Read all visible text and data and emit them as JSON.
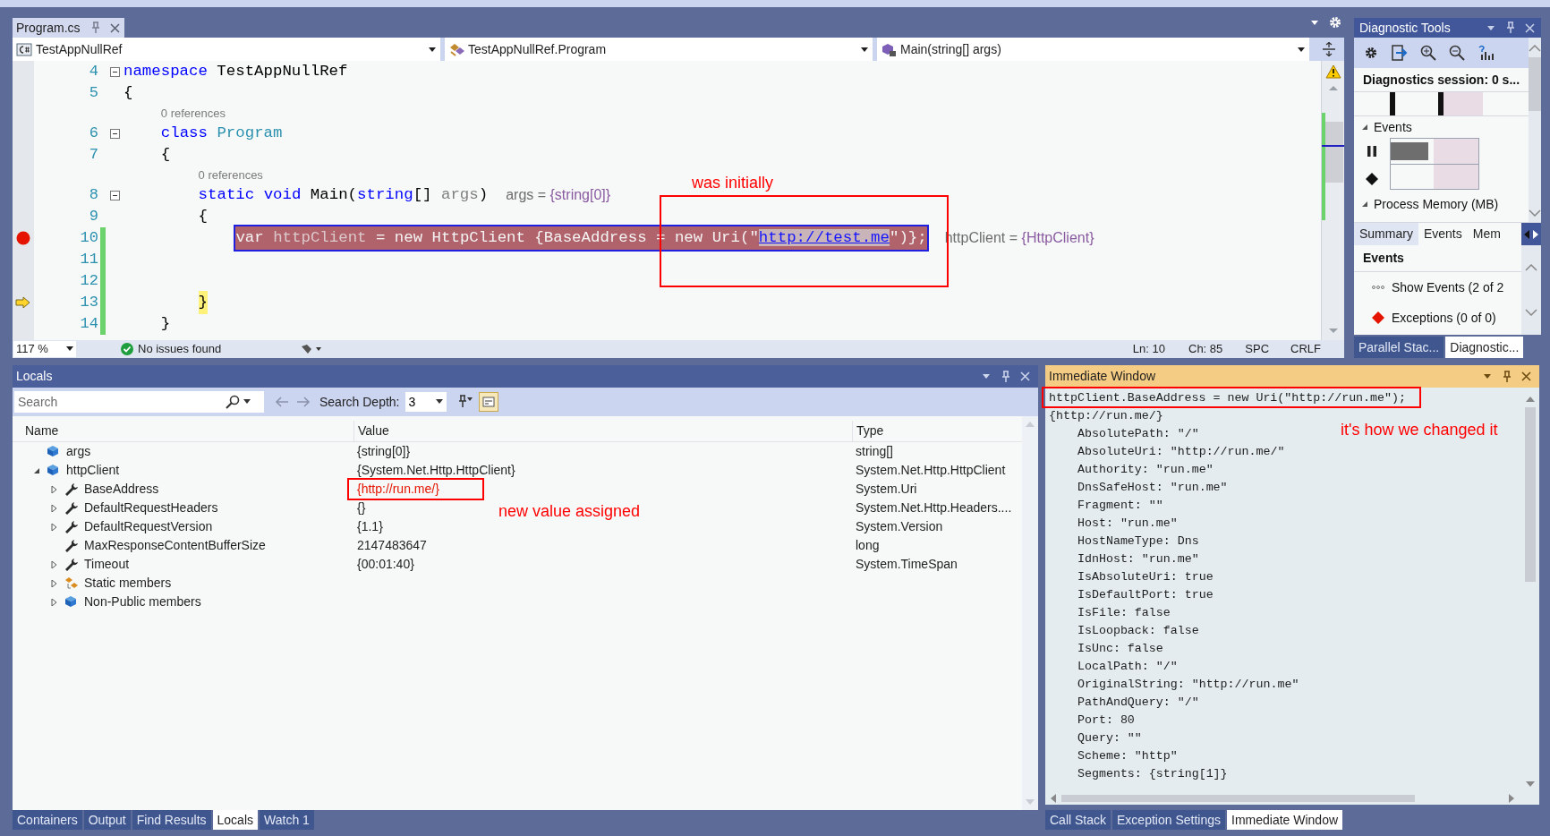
{
  "editor": {
    "tab": "Program.cs",
    "nav": [
      {
        "kind": "project",
        "label": "TestAppNullRef"
      },
      {
        "kind": "class",
        "label": "TestAppNullRef.Program"
      },
      {
        "kind": "method",
        "label": "Main(string[] args)"
      }
    ],
    "lines": [
      {
        "kind": "code",
        "number": "4",
        "foldable": true,
        "breakpoint": false,
        "current": false,
        "changed": false,
        "highlighted": false,
        "tokens": [
          {
            "kind": "keyword",
            "text": "namespace"
          },
          {
            "kind": "plain",
            "text": " TestAppNullRef"
          }
        ]
      },
      {
        "kind": "code",
        "number": "5",
        "foldable": false,
        "breakpoint": false,
        "current": false,
        "changed": false,
        "highlighted": false,
        "tokens": [
          {
            "kind": "plain",
            "text": "{"
          }
        ],
        "children": [
          {
            "kind": "lens",
            "foldable": false,
            "breakpoint": false,
            "current": false,
            "changed": false,
            "highlighted": false,
            "tokens": [
              {
                "kind": "lens",
                "text": "0 references"
              }
            ]
          },
          {
            "kind": "code",
            "number": "6",
            "foldable": true,
            "breakpoint": false,
            "current": false,
            "changed": false,
            "highlighted": false,
            "tokens": [
              {
                "kind": "keyword",
                "text": "class"
              },
              {
                "kind": "type",
                "text": " Program"
              }
            ]
          },
          {
            "kind": "code",
            "number": "7",
            "foldable": false,
            "breakpoint": false,
            "current": false,
            "changed": false,
            "highlighted": false,
            "tokens": [
              {
                "kind": "plain",
                "text": "{"
              }
            ],
            "children": [
              {
                "kind": "lens",
                "foldable": false,
                "breakpoint": false,
                "current": false,
                "changed": false,
                "highlighted": false,
                "tokens": [
                  {
                    "kind": "lens",
                    "text": "0 references"
                  }
                ]
              },
              {
                "kind": "code",
                "number": "8",
                "foldable": true,
                "breakpoint": false,
                "current": false,
                "changed": false,
                "highlighted": false,
                "tokens": [
                  {
                    "kind": "keyword",
                    "text": "static"
                  },
                  {
                    "kind": "keyword",
                    "text": " void"
                  },
                  {
                    "kind": "plain",
                    "text": " Main("
                  },
                  {
                    "kind": "keyword",
                    "text": "string"
                  },
                  {
                    "kind": "plain",
                    "text": "[] "
                  },
                  {
                    "kind": "param",
                    "text": "args"
                  },
                  {
                    "kind": "plain",
                    "text": ")"
                  }
                ],
                "hint": {
                  "name": "args = ",
                  "value": "{string[0]}"
                }
              },
              {
                "kind": "code",
                "number": "9",
                "foldable": false,
                "breakpoint": false,
                "current": false,
                "changed": false,
                "highlighted": false,
                "tokens": [
                  {
                    "kind": "plain",
                    "text": "{"
                  }
                ],
                "children": [
                  {
                    "kind": "code",
                    "number": "10",
                    "foldable": false,
                    "breakpoint": true,
                    "current": false,
                    "changed": true,
                    "highlighted": true,
                    "tokens": [
                      {
                        "kind": "keyword",
                        "text": "var"
                      },
                      {
                        "kind": "param",
                        "text": " httpClient"
                      },
                      {
                        "kind": "plain",
                        "text": " = "
                      },
                      {
                        "kind": "keyword",
                        "text": "new"
                      },
                      {
                        "kind": "plain",
                        "text": " HttpClient {BaseAddress = "
                      },
                      {
                        "kind": "keyword",
                        "text": "new"
                      },
                      {
                        "kind": "plain",
                        "text": " Uri(\""
                      },
                      {
                        "kind": "link",
                        "text": "http://test.me"
                      },
                      {
                        "kind": "plain",
                        "text": "\")};"
                      }
                    ],
                    "hint": {
                      "name": "httpClient = ",
                      "value": "{HttpClient}"
                    }
                  },
                  {
                    "kind": "code",
                    "number": "11",
                    "foldable": false,
                    "breakpoint": false,
                    "current": false,
                    "changed": true,
                    "highlighted": false
                  },
                  {
                    "kind": "code",
                    "number": "12",
                    "foldable": false,
                    "breakpoint": false,
                    "current": false,
                    "changed": true,
                    "highlighted": false
                  }
                ]
              },
              {
                "kind": "code",
                "number": "13",
                "foldable": false,
                "breakpoint": false,
                "current": true,
                "changed": true,
                "highlighted": false,
                "tokens": [
                  {
                    "kind": "plain",
                    "text": "}"
                  }
                ]
              }
            ]
          },
          {
            "kind": "code",
            "number": "14",
            "foldable": false,
            "breakpoint": false,
            "current": false,
            "changed": true,
            "highlighted": false,
            "tokens": [
              {
                "kind": "plain",
                "text": "}"
              }
            ]
          }
        ]
      }
    ],
    "annotation": "was initially",
    "status": {
      "zoom": "117 %",
      "issues": "No issues found",
      "ln": "Ln: 10",
      "ch": "Ch: 85",
      "spaces": "SPC",
      "eol": "CRLF"
    }
  },
  "diagnostics": {
    "title": "Diagnostic Tools",
    "session": "Diagnostics session: 0 s...",
    "sections": [
      {
        "label": "Events",
        "expanded": true
      },
      {
        "label": "Process Memory (MB)",
        "expanded": true
      }
    ],
    "tabs": [
      {
        "label": "Summary",
        "selected": true
      },
      {
        "label": "Events",
        "selected": false
      },
      {
        "label": "Mem",
        "selected": false
      }
    ],
    "heading": "Events",
    "items": [
      {
        "kind": "events",
        "label": "Show Events (2 of 2"
      },
      {
        "kind": "exceptions",
        "label": "Exceptions (0 of 0)"
      }
    ],
    "bottom_tabs": [
      {
        "label": "Parallel Stac...",
        "selected": false
      },
      {
        "label": "Diagnostic...",
        "selected": true
      }
    ]
  },
  "locals": {
    "title": "Locals",
    "search_placeholder": "Search",
    "depth_label": "Search Depth:",
    "depth": "3",
    "columns": [
      "Name",
      "Value",
      "Type"
    ],
    "rows": [
      {
        "name": "args",
        "value": "{string[0]}",
        "type": "string[]",
        "kind": "field",
        "expandable": false,
        "changed": false
      },
      {
        "name": "httpClient",
        "value": "{System.Net.Http.HttpClient}",
        "type": "System.Net.Http.HttpClient",
        "kind": "field",
        "expandable": true,
        "expanded": true,
        "changed": false,
        "children": [
          {
            "name": "BaseAddress",
            "value": "{http://run.me/}",
            "type": "System.Uri",
            "kind": "property",
            "expandable": true,
            "expanded": false,
            "changed": true
          },
          {
            "name": "DefaultRequestHeaders",
            "value": "{}",
            "type": "System.Net.Http.Headers....",
            "kind": "property",
            "expandable": true,
            "expanded": false,
            "changed": false
          },
          {
            "name": "DefaultRequestVersion",
            "value": "{1.1}",
            "type": "System.Version",
            "kind": "property",
            "expandable": true,
            "expanded": false,
            "changed": false
          },
          {
            "name": "MaxResponseContentBufferSize",
            "value": "2147483647",
            "type": "long",
            "kind": "property",
            "expandable": false,
            "changed": false
          },
          {
            "name": "Timeout",
            "value": "{00:01:40}",
            "type": "System.TimeSpan",
            "kind": "property",
            "expandable": true,
            "expanded": false,
            "changed": false
          },
          {
            "name": "Static members",
            "kind": "static",
            "expandable": true,
            "expanded": false
          },
          {
            "name": "Non-Public members",
            "kind": "field",
            "expandable": true,
            "expanded": false
          }
        ]
      }
    ],
    "annotation": "new value assigned",
    "tabs": [
      {
        "label": "Containers",
        "selected": false
      },
      {
        "label": "Output",
        "selected": false
      },
      {
        "label": "Find Results",
        "selected": false
      },
      {
        "label": "Locals",
        "selected": true
      },
      {
        "label": "Watch 1",
        "selected": false
      }
    ]
  },
  "immediate": {
    "title": "Immediate Window",
    "input": "httpClient.BaseAddress = new Uri(\"http://run.me\");",
    "result": {
      "text": "{http://run.me/}",
      "children": [
        {
          "text": "AbsolutePath: \"/\""
        },
        {
          "text": "AbsoluteUri: \"http://run.me/\""
        },
        {
          "text": "Authority: \"run.me\""
        },
        {
          "text": "DnsSafeHost: \"run.me\""
        },
        {
          "text": "Fragment: \"\""
        },
        {
          "text": "Host: \"run.me\""
        },
        {
          "text": "HostNameType: Dns"
        },
        {
          "text": "IdnHost: \"run.me\""
        },
        {
          "text": "IsAbsoluteUri: true"
        },
        {
          "text": "IsDefaultPort: true"
        },
        {
          "text": "IsFile: false"
        },
        {
          "text": "IsLoopback: false"
        },
        {
          "text": "IsUnc: false"
        },
        {
          "text": "LocalPath: \"/\""
        },
        {
          "text": "OriginalString: \"http://run.me\""
        },
        {
          "text": "PathAndQuery: \"/\""
        },
        {
          "text": "Port: 80"
        },
        {
          "text": "Query: \"\""
        },
        {
          "text": "Scheme: \"http\""
        },
        {
          "text": "Segments: {string[1]}"
        }
      ]
    },
    "annotation": "it's how we changed it",
    "tabs": [
      {
        "label": "Call Stack",
        "selected": false
      },
      {
        "label": "Exception Settings",
        "selected": false
      },
      {
        "label": "Immediate Window",
        "selected": true
      }
    ]
  }
}
